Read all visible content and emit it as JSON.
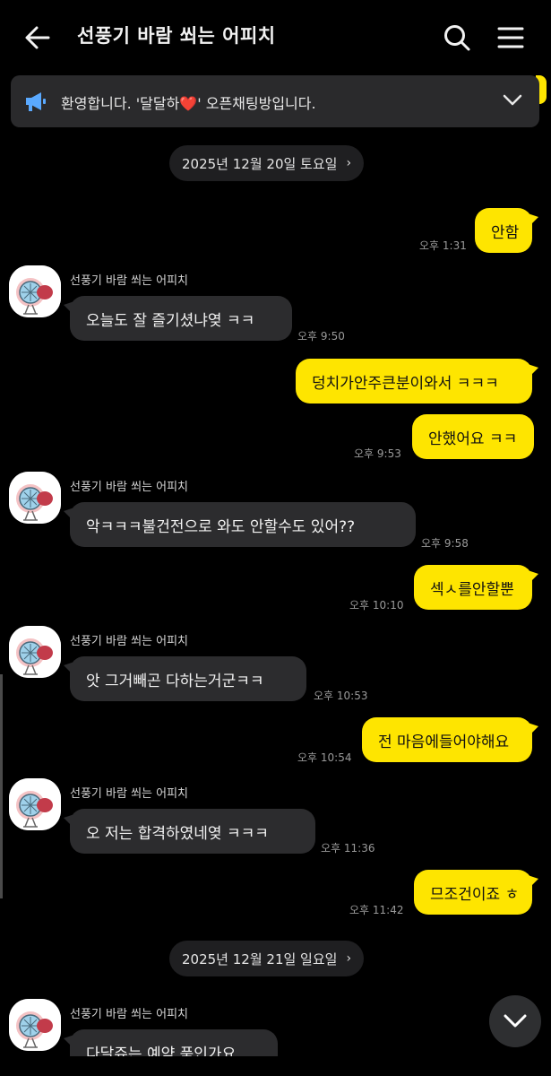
{
  "header": {
    "title": "선풍기 바람 쐬는 어피치",
    "back_icon": "arrow-left-icon",
    "search_icon": "search-icon",
    "menu_icon": "hamburger-menu-icon"
  },
  "notice": {
    "icon": "megaphone-icon",
    "text": "환영합니다. '달달하❤️' 오픈채팅방입니다.",
    "expand_icon": "chevron-down-icon"
  },
  "dates": {
    "first": "2025년 12월 20일 토요일",
    "second": "2025년 12월 21일 일요일",
    "chevron": "›"
  },
  "sender_name": "선풍기 바람 쐬는 어피치",
  "messages": [
    {
      "from": "me",
      "text": "안함",
      "time": "오후 1:31"
    },
    {
      "from": "other",
      "text": "오늘도 잘 즐기셨냐옂 ㅋㅋ",
      "time": "오후 9:50"
    },
    {
      "from": "me",
      "text": "덩치가안주큰분이와서 ㅋㅋㅋ",
      "time": ""
    },
    {
      "from": "me",
      "text": "안했어요 ㅋㅋ",
      "time": "오후 9:53"
    },
    {
      "from": "other",
      "text": "악ㅋㅋㅋ불건전으로 와도 안할수도 있어??",
      "time": "오후 9:58"
    },
    {
      "from": "me",
      "text": "섹ㅅ를안할뿐",
      "time": "오후 10:10"
    },
    {
      "from": "other",
      "text": "앗 그거빼곤 다하는거군ㅋㅋ",
      "time": "오후 10:53"
    },
    {
      "from": "me",
      "text": "전 마음에들어야해요",
      "time": "오후 10:54"
    },
    {
      "from": "other",
      "text": "오 저는 합격하였네옂 ㅋㅋㅋ",
      "time": "오후 11:36"
    },
    {
      "from": "me",
      "text": "므조건이죠 ㅎ",
      "time": "오후 11:42"
    },
    {
      "from": "other",
      "text": "다달쥬는 예약 품인가요",
      "time": ""
    }
  ],
  "fab": {
    "icon": "chevron-down-icon"
  },
  "colors": {
    "background": "#000000",
    "my_bubble": "#fee500",
    "their_bubble": "#2c2c2e",
    "notice_bg": "#2a2a2c",
    "megaphone": "#5aa9ff"
  }
}
